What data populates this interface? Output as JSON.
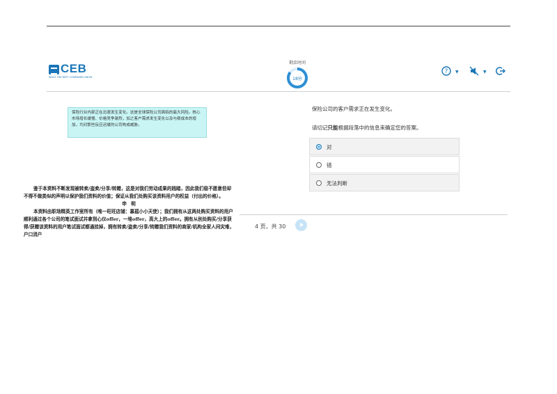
{
  "header": {
    "logo_text": "CEB",
    "logo_tagline": "WHAT THE BEST COMPANIES KNOW",
    "timer_label": "剩余时间",
    "timer_value": "18分",
    "timer_fraction": 0.85,
    "icons": [
      "help-icon",
      "sound-off-icon",
      "exit-icon"
    ]
  },
  "passage": {
    "text": "保险行业内部正在迅速发生变化。这是全球保险公司面临的最大风险。核心市场增长缓慢、价格竞争激烈，加之客户需求发生变化以及与损成本的增加，均对那些反应迟缓的公司构成威胁。"
  },
  "watermark": {
    "para1": "鉴于本资料不断发现被转卖/盗卖/分享/转赠，这是对我们劳动成果的践踏，因此我们极不愿意但却不得不做类似的声明以保护我们资料的价值；保证从我们处购买该资料用户的权益（付出的价格）。",
    "title": "申  明",
    "para2": "本资料由职场精英工作室所有（唯一旺旺店铺：慕孤小小天使）；我们拥有从这两处购买资料的用户顺利通过各个公司的笔试面试并拿到心仪offer，一堆offer，高大上的offer。拥有从别处购买/分享获得/获赠该资料的用户笔试面试都通挂掉，拥有转卖/盗卖/分享/转赠我们资料的商家/机构全家人间灾难，户口消户"
  },
  "question": {
    "statement": "保险公司的客户需求正在发生变化。",
    "instruction_pre": "请切记",
    "instruction_bold": "只能",
    "instruction_post": "根据段落中的信息来确定您的答案。",
    "options": [
      {
        "label": "对",
        "selected": true
      },
      {
        "label": "错",
        "selected": false
      },
      {
        "label": "无法判断",
        "selected": false
      }
    ]
  },
  "pager": {
    "text": "4 页，共 30"
  },
  "colors": {
    "accent": "#1a76b8",
    "passage_bg": "#c9f5f5"
  }
}
